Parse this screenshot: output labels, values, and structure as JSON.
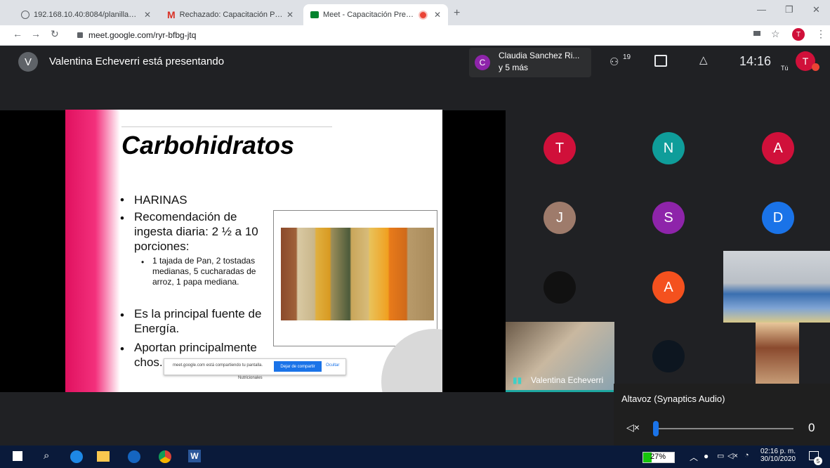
{
  "browser": {
    "tabs": [
      {
        "label": "192.168.10.40:8084/planillaUsuar",
        "icon": "globe-icon"
      },
      {
        "label": "Rechazado: Capacitación Preven",
        "icon": "gmail-icon"
      },
      {
        "label": "Meet - Capacitación Preven",
        "icon": "meet-icon",
        "active": true
      }
    ],
    "new_tab": "+",
    "url": "meet.google.com/ryr-bfbg-jtq",
    "profile_initial": "T"
  },
  "meet": {
    "presenter_initial": "V",
    "presenter_text": "Valentina Echeverri está presentando",
    "participant_chip": {
      "initial": "C",
      "name": "Claudia Sanchez Ri...",
      "more": "y 5 más"
    },
    "people_count": "19",
    "time": "14:16",
    "self_label": "Tú",
    "self_initial": "T"
  },
  "slide": {
    "title": "Carbohidratos",
    "bullets": [
      "HARINAS",
      "Recomendación de ingesta diaria:  2 ½ a 10 porciones:",
      "Es la principal fuente de Energía.",
      "Aportan principalmente chos."
    ],
    "sub_bullet": "1 tajada de Pan, 2 tostadas medianas, 5 cucharadas de arroz, 1 papa mediana.",
    "logo_text": "Soluciones Nutricionales",
    "share_bar": {
      "text": "meet.google.com está compartiendo tu pantalla.",
      "stop": "Dejar de compartir",
      "hide": "Ocultar"
    }
  },
  "participants": [
    {
      "initial": "T",
      "color": "#d0103a"
    },
    {
      "initial": "N",
      "color": "#0f9d9a"
    },
    {
      "initial": "A",
      "color": "#d0103a"
    },
    {
      "initial": "J",
      "color": "#9e7b6b"
    },
    {
      "initial": "S",
      "color": "#8e24aa"
    },
    {
      "initial": "D",
      "color": "#1a73e8"
    },
    {
      "initial": "A",
      "color": "#f4511e"
    }
  ],
  "video_tile_name": "Valentina Echeverri",
  "audio_popup": {
    "title": "Altavoz (Synaptics Audio)",
    "value": "0"
  },
  "taskbar": {
    "battery": "27%",
    "clock_time": "02:16 p. m.",
    "clock_date": "30/10/2020",
    "notif_count": "5"
  }
}
